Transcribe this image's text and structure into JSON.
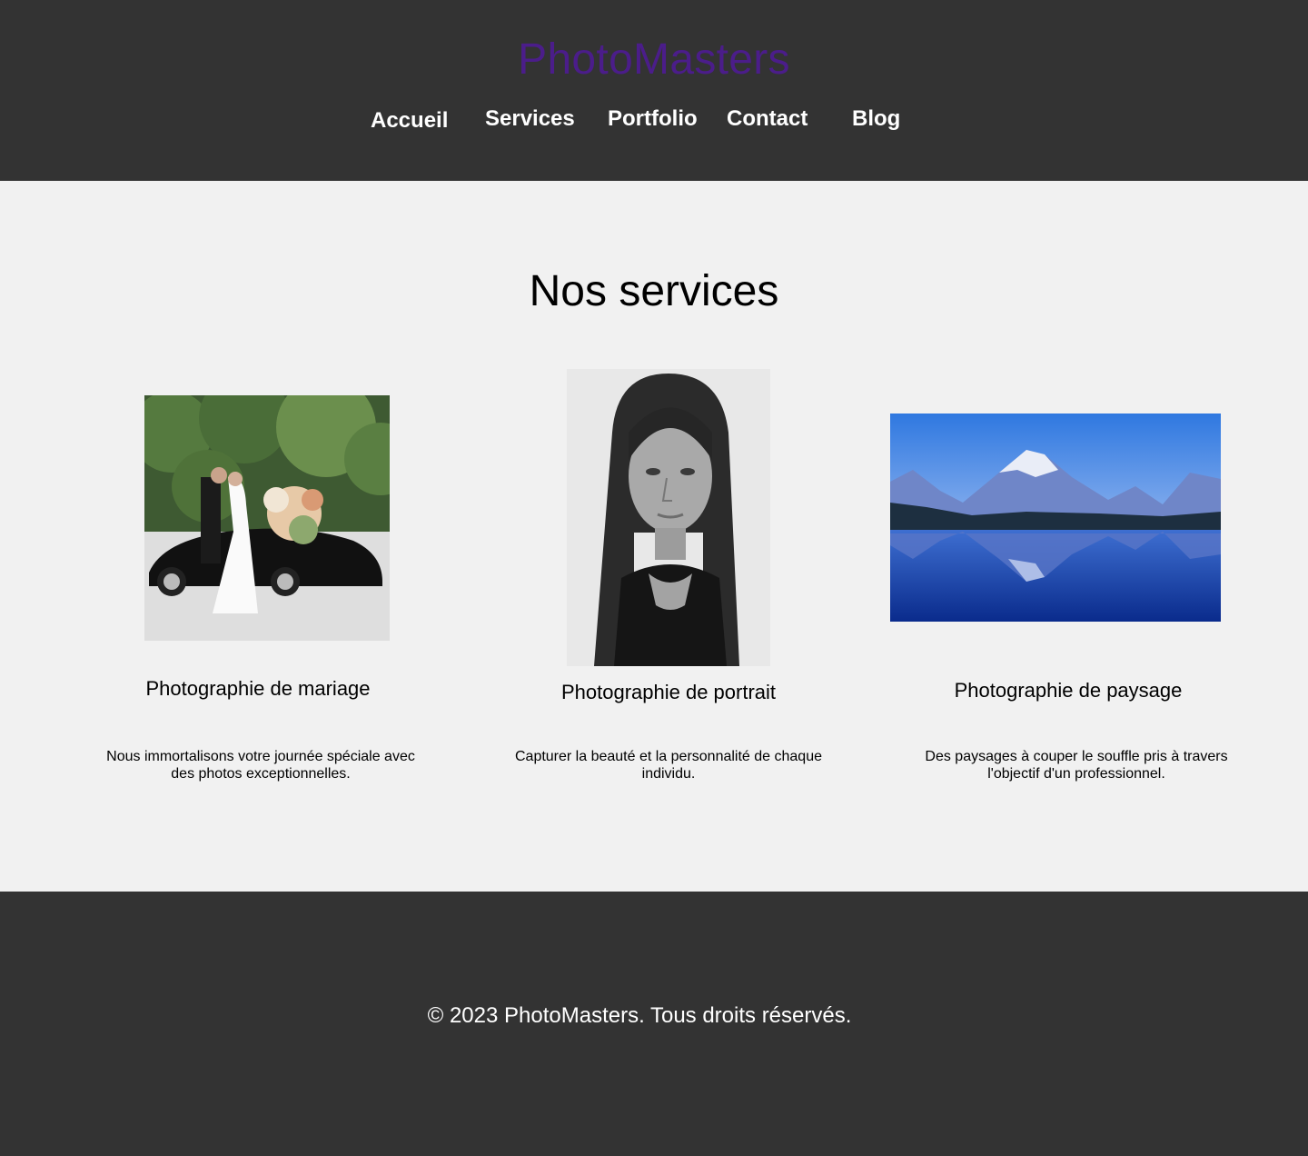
{
  "header": {
    "brand": "PhotoMasters",
    "brand_color": "#4b1d8a",
    "background_color": "#333333",
    "nav": [
      {
        "label": "Accueil"
      },
      {
        "label": "Services"
      },
      {
        "label": "Portfolio"
      },
      {
        "label": "Contact"
      },
      {
        "label": "Blog"
      }
    ]
  },
  "main": {
    "title": "Nos services",
    "background_color": "#f1f1f1",
    "services": [
      {
        "image": "wedding-photo",
        "title": "Photographie de mariage",
        "description": "Nous immortalisons votre journée spéciale avec des photos exceptionnelles."
      },
      {
        "image": "portrait-photo",
        "title": "Photographie de portrait",
        "description": "Capturer la beauté et la personnalité de chaque individu."
      },
      {
        "image": "landscape-photo",
        "title": "Photographie de paysage",
        "description": "Des paysages à couper le souffle pris à travers l'objectif d'un professionnel."
      }
    ]
  },
  "footer": {
    "copyright": "© 2023 PhotoMasters. Tous droits réservés."
  }
}
